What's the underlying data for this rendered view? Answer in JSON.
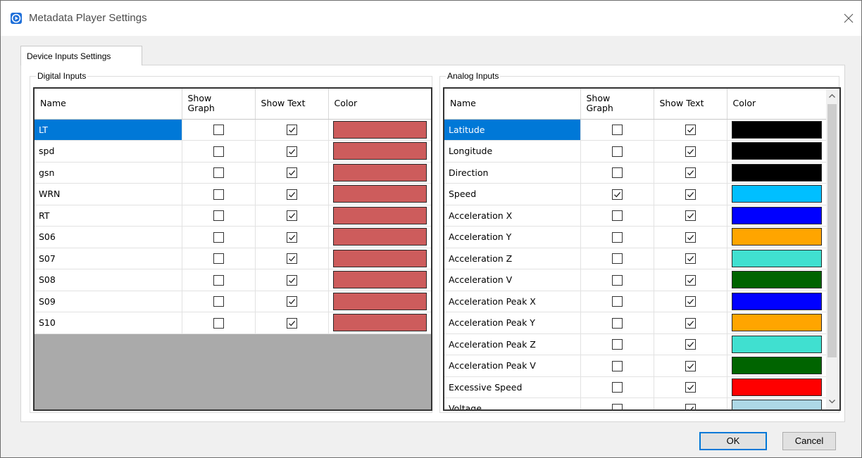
{
  "window": {
    "title": "Metadata Player Settings"
  },
  "tab": {
    "label": "Device Inputs Settings"
  },
  "digital": {
    "group_label": "Digital Inputs",
    "columns": [
      "Name",
      "Show Graph",
      "Show Text",
      "Color"
    ],
    "rows": [
      {
        "name": "LT",
        "show_graph": false,
        "show_text": true,
        "color": "#cd5c5c",
        "selected": true
      },
      {
        "name": "spd",
        "show_graph": false,
        "show_text": true,
        "color": "#cd5c5c",
        "selected": false
      },
      {
        "name": "gsn",
        "show_graph": false,
        "show_text": true,
        "color": "#cd5c5c",
        "selected": false
      },
      {
        "name": "WRN",
        "show_graph": false,
        "show_text": true,
        "color": "#cd5c5c",
        "selected": false
      },
      {
        "name": "RT",
        "show_graph": false,
        "show_text": true,
        "color": "#cd5c5c",
        "selected": false
      },
      {
        "name": "S06",
        "show_graph": false,
        "show_text": true,
        "color": "#cd5c5c",
        "selected": false
      },
      {
        "name": "S07",
        "show_graph": false,
        "show_text": true,
        "color": "#cd5c5c",
        "selected": false
      },
      {
        "name": "S08",
        "show_graph": false,
        "show_text": true,
        "color": "#cd5c5c",
        "selected": false
      },
      {
        "name": "S09",
        "show_graph": false,
        "show_text": true,
        "color": "#cd5c5c",
        "selected": false
      },
      {
        "name": "S10",
        "show_graph": false,
        "show_text": true,
        "color": "#cd5c5c",
        "selected": false
      }
    ]
  },
  "analog": {
    "group_label": "Analog Inputs",
    "columns": [
      "Name",
      "Show Graph",
      "Show Text",
      "Color"
    ],
    "rows": [
      {
        "name": "Latitude",
        "show_graph": false,
        "show_text": true,
        "color": "#000000",
        "selected": true
      },
      {
        "name": "Longitude",
        "show_graph": false,
        "show_text": true,
        "color": "#000000",
        "selected": false
      },
      {
        "name": "Direction",
        "show_graph": false,
        "show_text": true,
        "color": "#000000",
        "selected": false
      },
      {
        "name": "Speed",
        "show_graph": true,
        "show_text": true,
        "color": "#00bfff",
        "selected": false
      },
      {
        "name": "Acceleration X",
        "show_graph": false,
        "show_text": true,
        "color": "#0000ff",
        "selected": false
      },
      {
        "name": "Acceleration Y",
        "show_graph": false,
        "show_text": true,
        "color": "#ffa500",
        "selected": false
      },
      {
        "name": "Acceleration Z",
        "show_graph": false,
        "show_text": true,
        "color": "#40e0d0",
        "selected": false
      },
      {
        "name": "Acceleration V",
        "show_graph": false,
        "show_text": true,
        "color": "#006400",
        "selected": false
      },
      {
        "name": "Acceleration Peak X",
        "show_graph": false,
        "show_text": true,
        "color": "#0000ff",
        "selected": false
      },
      {
        "name": "Acceleration Peak Y",
        "show_graph": false,
        "show_text": true,
        "color": "#ffa500",
        "selected": false
      },
      {
        "name": "Acceleration Peak Z",
        "show_graph": false,
        "show_text": true,
        "color": "#40e0d0",
        "selected": false
      },
      {
        "name": "Acceleration Peak V",
        "show_graph": false,
        "show_text": true,
        "color": "#006400",
        "selected": false
      },
      {
        "name": "Excessive Speed",
        "show_graph": false,
        "show_text": true,
        "color": "#ff0000",
        "selected": false
      },
      {
        "name": "Voltage",
        "show_graph": false,
        "show_text": true,
        "color": "#add8e6",
        "selected": false
      }
    ]
  },
  "buttons": {
    "ok": "OK",
    "cancel": "Cancel"
  },
  "icons": {
    "app": "play-circle-icon",
    "close": "close-icon",
    "checkbox_checked": "check-icon",
    "scroll_up": "chevron-up-icon",
    "scroll_down": "chevron-down-icon"
  }
}
